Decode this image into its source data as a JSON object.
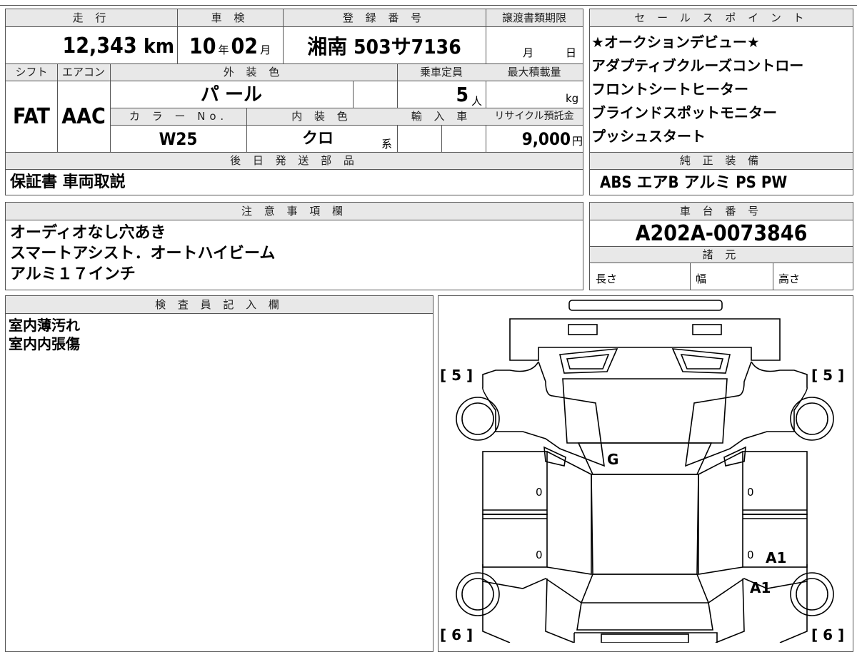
{
  "vehicle": {
    "mileage_label": "走 行",
    "mileage_value": "12,343",
    "mileage_unit": "km",
    "inspection_label": "車 検",
    "inspection_year": "10",
    "inspection_year_unit": "年",
    "inspection_month": "02",
    "inspection_month_unit": "月",
    "registration_label": "登 録 番 号",
    "registration_value": "湘南 503サ7136",
    "transfer_label": "譲渡書類期限",
    "transfer_month_unit": "月",
    "transfer_day_unit": "日",
    "shift_label": "シフト",
    "shift_value": "FAT",
    "ac_label": "エアコン",
    "ac_value": "AAC",
    "exterior_label": "外 装 色",
    "exterior_value": "パ ール",
    "capacity_label": "乗車定員",
    "capacity_value": "5",
    "capacity_unit": "人",
    "max_load_label": "最大積載量",
    "max_load_unit": "kg",
    "color_no_label": "カ ラ ー No.",
    "color_no_value": "W25",
    "interior_label": "内 装 色",
    "interior_value": "クロ",
    "interior_unit": "系",
    "import_label": "輸 入 車",
    "recycle_label": "リサイクル預託金",
    "recycle_value": "9,000",
    "recycle_unit": "円"
  },
  "later_parts": {
    "label": "後 日 発 送 部 品",
    "value": "保証書 車両取説"
  },
  "sales_points": {
    "label": "セ ー ル ス ポ イ ン ト",
    "items": [
      "★オークションデビュー★",
      "アダプティブクルーズコントロー",
      "フロントシートヒーター",
      "ブラインドスポットモニター",
      "プッシュスタート"
    ]
  },
  "equipment": {
    "label": "純 正 装 備",
    "value": "ABS エアB アルミ PS PW"
  },
  "notes": {
    "label": "注 意 事 項 欄",
    "lines": [
      "オーディオなし穴あき",
      "スマートアシスト．オートハイビーム",
      "アルミ１７インチ"
    ]
  },
  "chassis": {
    "label": "車 台 番 号",
    "value": "A202A-0073846",
    "specs_label": "諸 元",
    "length_label": "長さ",
    "width_label": "幅",
    "height_label": "高さ"
  },
  "inspector": {
    "label": "検 査 員 記 入 欄",
    "lines": [
      "室内薄汚れ",
      "室内内張傷"
    ]
  },
  "diagram": {
    "front_left_tire": "[ 5 ]",
    "front_right_tire": "[ 5 ]",
    "rear_left_tire": "[ 6 ]",
    "rear_right_tire": "[ 6 ]",
    "windshield_mark": "G",
    "panel_mark_fl": "0",
    "panel_mark_rl": "0",
    "panel_mark_fr": "0",
    "panel_mark_rr": "0",
    "damage_mark_rr_door": "A1",
    "damage_mark_rr_wheel": "A1"
  }
}
